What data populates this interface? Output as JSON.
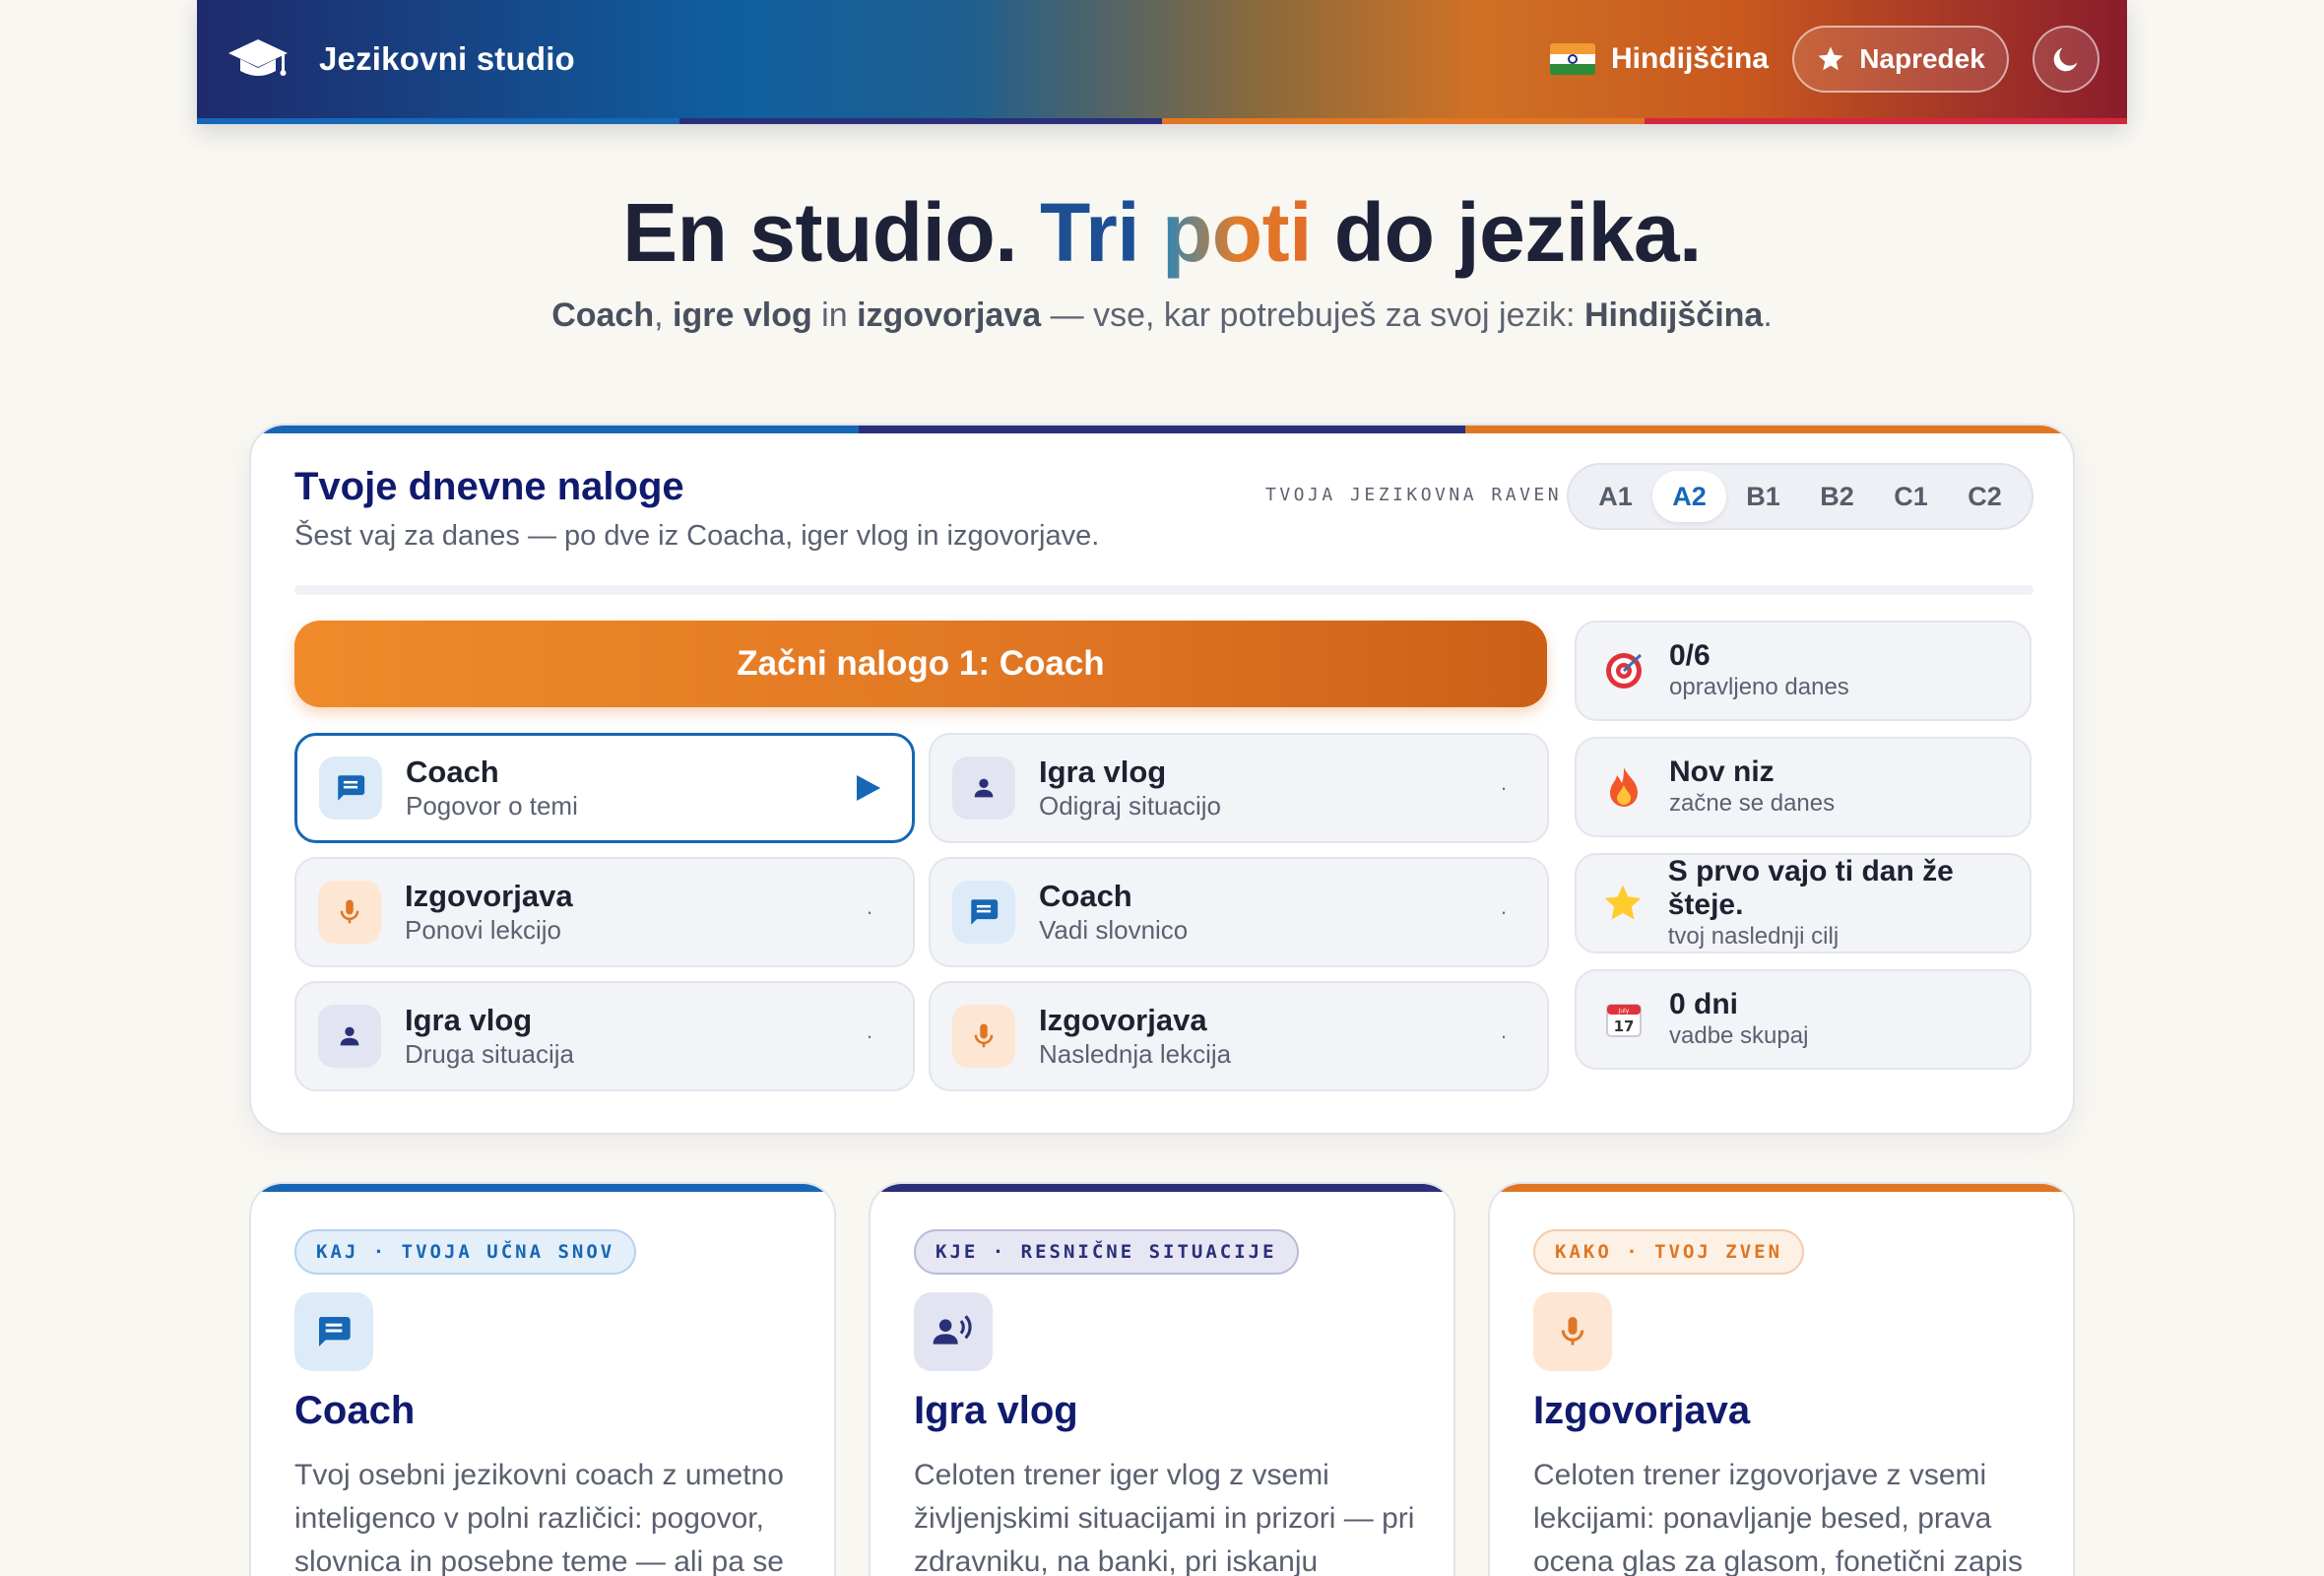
{
  "header": {
    "brand": "Jezikovni studio",
    "language": "Hindijščina",
    "progress_label": "Napredek",
    "colors": {
      "stripe": [
        "#1667b6",
        "#1e2a6b",
        "#e07623",
        "#c81e3c"
      ]
    }
  },
  "hero": {
    "title_part1": "En studio.",
    "title_tri": "Tri",
    "title_poti": "poti",
    "title_part2": "do jezika.",
    "sub_coach": "Coach",
    "sub_comma": ", ",
    "sub_games": "igre vlog",
    "sub_in": " in ",
    "sub_pron": "izgovorjava",
    "sub_rest": " — vse, kar potrebuješ za svoj jezik: ",
    "sub_lang": "Hindijščina",
    "sub_dot": "."
  },
  "tasks_panel": {
    "title": "Tvoje dnevne naloge",
    "subtitle": "Šest vaj za danes — po dve iz Coacha, iger vlog in izgovorjave.",
    "level_label": "TVOJA JEZIKOVNA RAVEN",
    "levels": [
      "A1",
      "A2",
      "B1",
      "B2",
      "C1",
      "C2"
    ],
    "active_level": "A2",
    "start_button": "Začni nalogo 1: Coach",
    "tasks": [
      {
        "title": "Coach",
        "subtitle": "Pogovor o temi",
        "icon": "chat-icon",
        "end": ""
      },
      {
        "title": "Igra vlog",
        "subtitle": "Odigraj situacijo",
        "icon": "person-icon",
        "end": "·"
      },
      {
        "title": "Izgovorjava",
        "subtitle": "Ponovi lekcijo",
        "icon": "microphone-icon",
        "end": "·"
      },
      {
        "title": "Coach",
        "subtitle": "Vadi slovnico",
        "icon": "chat-icon",
        "end": "·"
      },
      {
        "title": "Igra vlog",
        "subtitle": "Druga situacija",
        "icon": "person-icon",
        "end": "·"
      },
      {
        "title": "Izgovorjava",
        "subtitle": "Naslednja lekcija",
        "icon": "microphone-icon",
        "end": "·"
      }
    ],
    "stats": [
      {
        "main": "0/6",
        "label": "opravljeno danes",
        "icon": "target-icon"
      },
      {
        "main": "Nov niz",
        "label": "začne se danes",
        "icon": "fire-icon"
      },
      {
        "main": "S prvo vajo ti dan že šteje.",
        "label": "tvoj naslednji cilj",
        "icon": "star-icon"
      },
      {
        "main": "0 dni",
        "label": "vadbe skupaj",
        "icon": "calendar-icon",
        "calendar_day": "17",
        "calendar_month": "July"
      }
    ]
  },
  "cards": [
    {
      "badge": "KAJ · TVOJA UČNA SNOV",
      "title": "Coach",
      "desc": "Tvoj osebni jezikovni coach z umetno inteligenco v polni različici: pogovor, slovnica in posebne teme — ali pa se",
      "accent": "#1667b6"
    },
    {
      "badge": "KJE · RESNIČNE SITUACIJE",
      "title": "Igra vlog",
      "desc": "Celoten trener iger vlog z vsemi življenjskimi situacijami in prizori — pri zdravniku, na banki, pri iskanju",
      "accent": "#2a2f7a"
    },
    {
      "badge": "KAKO · TVOJ ZVEN",
      "title": "Izgovorjava",
      "desc": "Celoten trener izgovorjave z vsemi lekcijami: ponavljanje besed, prava ocena glas za glasom, fonetični zapis",
      "accent": "#e07623"
    }
  ]
}
